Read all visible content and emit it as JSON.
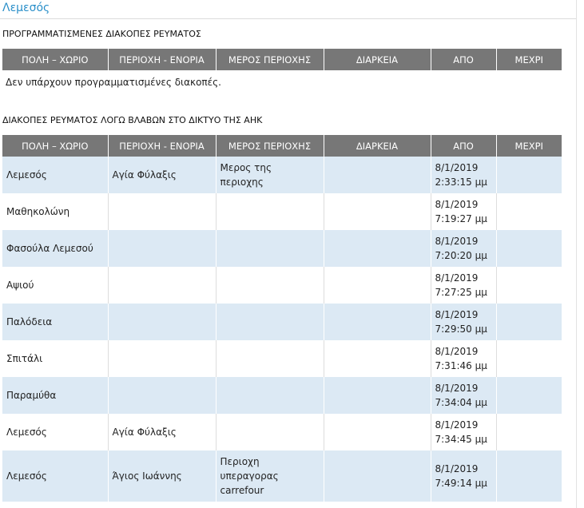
{
  "city_title": "Λεμεσός",
  "scheduled": {
    "title": "ΠΡΟΓΡΑΜΜΑΤΙΣΜΕΝΕΣ ΔΙΑΚΟΠΕΣ ΡΕΥΜΑΤΟΣ",
    "columns": [
      "ΠΟΛΗ – ΧΩΡΙΟ",
      "ΠΕΡΙΟΧΗ - ΕΝΟΡΙΑ",
      "ΜΕΡΟΣ ΠΕΡΙΟΧΗΣ",
      "ΔΙΑΡΚΕΙΑ",
      "ΑΠΟ",
      "ΜΕΧΡΙ"
    ],
    "empty_message": "Δεν υπάρχουν προγραμματισμένες διακοπές."
  },
  "faults": {
    "title": "ΔΙΑΚΟΠΕΣ ΡΕΥΜΑΤΟΣ ΛΟΓΩ ΒΛΑΒΩΝ ΣΤΟ ΔΙΚΤΥΟ ΤΗΣ ΑΗΚ",
    "columns": [
      "ΠΟΛΗ – ΧΩΡΙΟ",
      "ΠΕΡΙΟΧΗ - ΕΝΟΡΙΑ",
      "ΜΕΡΟΣ ΠΕΡΙΟΧΗΣ",
      "ΔΙΑΡΚΕΙΑ",
      "ΑΠΟ",
      "ΜΕΧΡΙ"
    ],
    "rows": [
      [
        "Λεμεσός",
        "Αγία Φύλαξις",
        "Μερος της\nπεριοχης",
        "",
        "8/1/2019\n2:33:15 μμ",
        ""
      ],
      [
        "Μαθηκολώνη",
        "",
        "",
        "",
        "8/1/2019\n7:19:27 μμ",
        ""
      ],
      [
        "Φασούλα Λεμεσού",
        "",
        "",
        "",
        "8/1/2019\n7:20:20 μμ",
        ""
      ],
      [
        "Αψιού",
        "",
        "",
        "",
        "8/1/2019\n7:27:25 μμ",
        ""
      ],
      [
        "Παλόδεια",
        "",
        "",
        "",
        "8/1/2019\n7:29:50 μμ",
        ""
      ],
      [
        "Σπιτάλι",
        "",
        "",
        "",
        "8/1/2019\n7:31:46 μμ",
        ""
      ],
      [
        "Παραμύθα",
        "",
        "",
        "",
        "8/1/2019\n7:34:04 μμ",
        ""
      ],
      [
        "Λεμεσός",
        "Αγία Φύλαξις",
        "",
        "",
        "8/1/2019\n7:34:45 μμ",
        ""
      ],
      [
        "Λεμεσός",
        "Άγιος Ιωάννης",
        "Περιοχη\nυπεραγορας\ncarrefour",
        "",
        "8/1/2019\n7:49:14 μμ",
        ""
      ]
    ]
  }
}
